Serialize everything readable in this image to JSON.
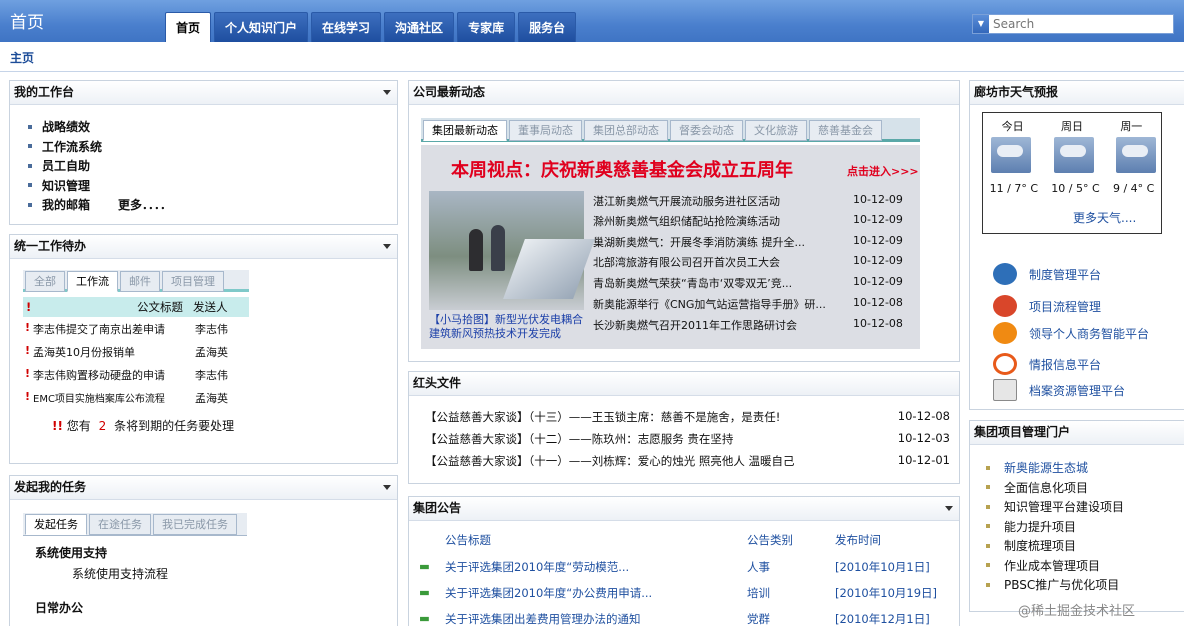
{
  "header": {
    "brand": "首页",
    "tabs": [
      "首页",
      "个人知识门户",
      "在线学习",
      "沟通社区",
      "专家库",
      "服务台"
    ],
    "search_placeholder": "Search"
  },
  "breadcrumb": "主页",
  "workbench": {
    "title": "我的工作台",
    "items": [
      "战略绩效",
      "工作流系统",
      "员工自助",
      "知识管理",
      "我的邮箱"
    ],
    "more": "更多．．．．"
  },
  "todo": {
    "title": "统一工作待办",
    "tabs": [
      "全部",
      "工作流",
      "邮件",
      "项目管理"
    ],
    "col_mark": "!",
    "col_title": "公文标题",
    "col_sender": "发送人",
    "rows": [
      {
        "title": "李志伟提交了南京出差申请",
        "sender": "李志伟"
      },
      {
        "title": "孟海英10月份报销单",
        "sender": "孟海英"
      },
      {
        "title": "李志伟购置移动硬盘的申请",
        "sender": "李志伟"
      },
      {
        "title": "EMC项目实施档案库公布流程",
        "sender": "孟海英"
      }
    ],
    "notice_pre": "您有",
    "notice_count": "2",
    "notice_post": "条将到期的任务要处理"
  },
  "tasks": {
    "title": "发起我的任务",
    "tabs": [
      "发起任务",
      "在途任务",
      "我已完成任务"
    ],
    "group1": "系统使用支持",
    "item1": "系统使用支持流程",
    "group2": "日常办公"
  },
  "news": {
    "title": "公司最新动态",
    "tabs": [
      "集团最新动态",
      "董事局动态",
      "集团总部动态",
      "督委会动态",
      "文化旅游",
      "慈善基金会"
    ],
    "banner": "本周视点：庆祝新奥慈善基金会成立五周年",
    "banner_link": "点击进入>>>",
    "photo_caption": "【小马拾图】新型光伏发电耦合建筑新风预热技术开发完成",
    "items": [
      {
        "title": "湛江新奥燃气开展流动服务进社区活动",
        "date": "10-12-09"
      },
      {
        "title": "滁州新奥燃气组织储配站抢险演练活动",
        "date": "10-12-09"
      },
      {
        "title": "巢湖新奥燃气：开展冬季消防演练 提升全...",
        "date": "10-12-09"
      },
      {
        "title": "北部湾旅游有限公司召开首次员工大会",
        "date": "10-12-09"
      },
      {
        "title": "青岛新奥燃气荣获“青岛市‘双零双无’竞...",
        "date": "10-12-09"
      },
      {
        "title": "新奥能源举行《CNG加气站运营指导手册》研...",
        "date": "10-12-08"
      },
      {
        "title": "长沙新奥燃气召开2011年工作思路研讨会",
        "date": "10-12-08"
      }
    ]
  },
  "redhead": {
    "title": "红头文件",
    "items": [
      {
        "title": "【公益慈善大家谈】（十三）——王玉锁主席：慈善不是施舍，是责任!",
        "date": "10-12-08"
      },
      {
        "title": "【公益慈善大家谈】（十二）——陈玖州：志愿服务 贵在坚持",
        "date": "10-12-03"
      },
      {
        "title": "【公益慈善大家谈】（十一）——刘栋辉：爱心的烛光 照亮他人 温暖自己",
        "date": "10-12-01"
      }
    ]
  },
  "notices": {
    "title": "集团公告",
    "col_title": "公告标题",
    "col_type": "公告类别",
    "col_time": "发布时间",
    "rows": [
      {
        "title": "关于评选集团2010年度“劳动模范...",
        "type": "人事",
        "time": "[2010年10月1日]"
      },
      {
        "title": "关于评选集团2010年度“办公费用申请...",
        "type": "培训",
        "time": "[2010年10月19日]"
      },
      {
        "title": "关于评选集团出差费用管理办法的通知",
        "type": "党群",
        "time": "[2010年12月1日]"
      }
    ]
  },
  "weather": {
    "title": "廊坊市天气预报",
    "days": [
      {
        "label": "今日",
        "temp": "11 / 7° C"
      },
      {
        "label": "周日",
        "temp": "10 / 5° C"
      },
      {
        "label": "周一",
        "temp": "9 / 4° C"
      }
    ],
    "more": "更多天气....",
    "platforms": [
      "制度管理平台",
      "项目流程管理",
      "领导个人商务智能平台",
      "情报信息平台",
      "档案资源管理平台"
    ],
    "platform_colors": [
      "#2e6fb8",
      "#d9462a",
      "#f08a12",
      "#e85a1a",
      "#8a8a8a"
    ]
  },
  "projects": {
    "title": "集团项目管理门户",
    "items": [
      "新奥能源生态城",
      "全面信息化项目",
      "知识管理平台建设项目",
      "能力提升项目",
      "制度梳理项目",
      "作业成本管理项目",
      "PBSC推广与优化项目"
    ]
  },
  "watermark": "@稀土掘金技术社区"
}
